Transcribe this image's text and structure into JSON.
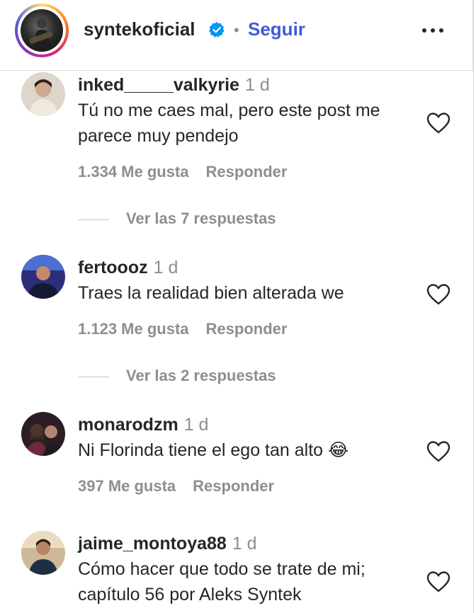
{
  "header": {
    "username": "syntekoficial",
    "follow_label": "Seguir",
    "separator": "•"
  },
  "comments": [
    {
      "username": "inked_____valkyrie",
      "time": "1 d",
      "text": "Tú no me caes mal, pero este post me parece muy pendejo",
      "likes": "1.334 Me gusta",
      "reply_label": "Responder",
      "view_replies": "Ver las 7 respuestas",
      "avatar_color": "#d9d3c8"
    },
    {
      "username": "fertoooz",
      "time": "1 d",
      "text": "Traes la realidad bien alterada we",
      "likes": "1.123 Me gusta",
      "reply_label": "Responder",
      "view_replies": "Ver las 2 respuestas",
      "avatar_color": "#3a3f8f"
    },
    {
      "username": "monarodzm",
      "time": "1 d",
      "text": "Ni Florinda tiene el ego tan alto 😂",
      "likes": "397 Me gusta",
      "reply_label": "Responder",
      "avatar_color": "#3a2a2a"
    },
    {
      "username": "jaime_montoya88",
      "time": "1 d",
      "text": "Cómo hacer que todo se trate de mi; capítulo 56 por Aleks Syntek",
      "avatar_color": "#c9b79a"
    }
  ],
  "icons": {
    "verified": "verified-badge-icon",
    "more": "more-options-icon",
    "heart": "heart-icon"
  },
  "colors": {
    "link_blue": "#3f5bd5",
    "verified_blue": "#0095f6",
    "secondary_text": "#8e8e8e"
  }
}
